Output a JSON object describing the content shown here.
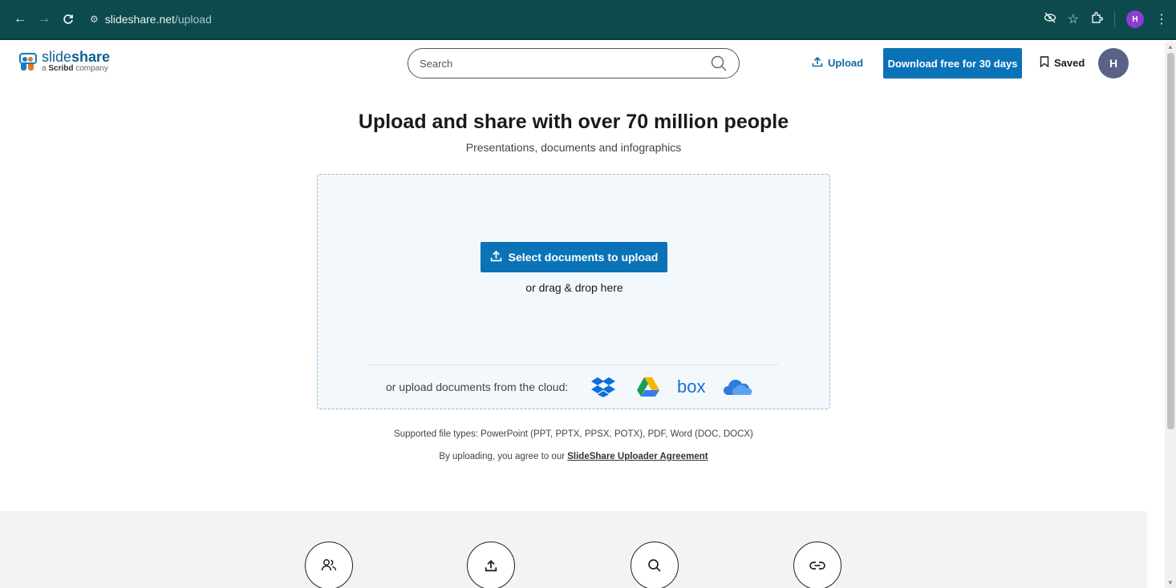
{
  "browser": {
    "url_domain": "slideshare.net",
    "url_path": "/upload",
    "profile_initial": "H"
  },
  "header": {
    "brand_light": "slide",
    "brand_bold": "share",
    "tagline_prefix": "a ",
    "tagline_bold": "Scribd",
    "tagline_suffix": " company",
    "search_placeholder": "Search",
    "upload_label": "Upload",
    "download_label": "Download free for 30 days",
    "saved_label": "Saved",
    "avatar_initial": "H"
  },
  "main": {
    "title": "Upload and share with over 70 million people",
    "subtitle": "Presentations, documents and infographics",
    "select_button": "Select documents to upload",
    "drag_text": "or drag & drop here",
    "cloud_label": "or upload documents from the cloud:",
    "cloud_box_label": "box",
    "supported_types": "Supported file types: PowerPoint (PPT, PPTX, PPSX, POTX), PDF, Word (DOC, DOCX)",
    "agree_prefix": "By uploading, you agree to our ",
    "agree_link": "SlideShare Uploader Agreement"
  },
  "colors": {
    "chrome_bg": "#0d4a4d",
    "primary_blue": "#0a73b8",
    "avatar_bg": "#5a6287",
    "dropzone_bg": "#f2f8fc"
  },
  "features": [
    {
      "icon": "people-icon"
    },
    {
      "icon": "upload-icon"
    },
    {
      "icon": "search-icon"
    },
    {
      "icon": "link-icon"
    }
  ]
}
